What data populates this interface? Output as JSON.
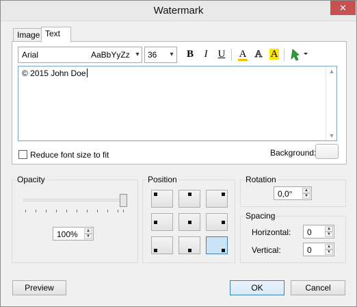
{
  "window": {
    "title": "Watermark",
    "close_glyph": "✕"
  },
  "tabs": [
    {
      "label": "Image",
      "active": false
    },
    {
      "label": "Text",
      "active": true
    }
  ],
  "text_tab": {
    "font_name": "Arial",
    "font_preview": "AaBbYyZz",
    "font_size": "36",
    "bold": "B",
    "italic": "I",
    "underline": "U",
    "font_color_glyph": "A",
    "outline_glyph": "A",
    "highlight_glyph": "A",
    "text": "© 2015 John Doe",
    "reduce_label": "Reduce font size to fit",
    "reduce_checked": false,
    "background_label": "Background:",
    "colors": {
      "font_underline": "#f2c200",
      "highlight": "#ffe600",
      "shadow_icon": "#2e9a3a"
    }
  },
  "opacity": {
    "title": "Opacity",
    "value": "100%",
    "level": 1.0
  },
  "position": {
    "title": "Position",
    "selected": "bottom-right"
  },
  "rotation": {
    "title": "Rotation",
    "value": "0,0°"
  },
  "spacing": {
    "title": "Spacing",
    "horizontal_label": "Horizontal:",
    "horizontal_value": "0",
    "vertical_label": "Vertical:",
    "vertical_value": "0"
  },
  "buttons": {
    "preview": "Preview",
    "ok": "OK",
    "cancel": "Cancel"
  }
}
